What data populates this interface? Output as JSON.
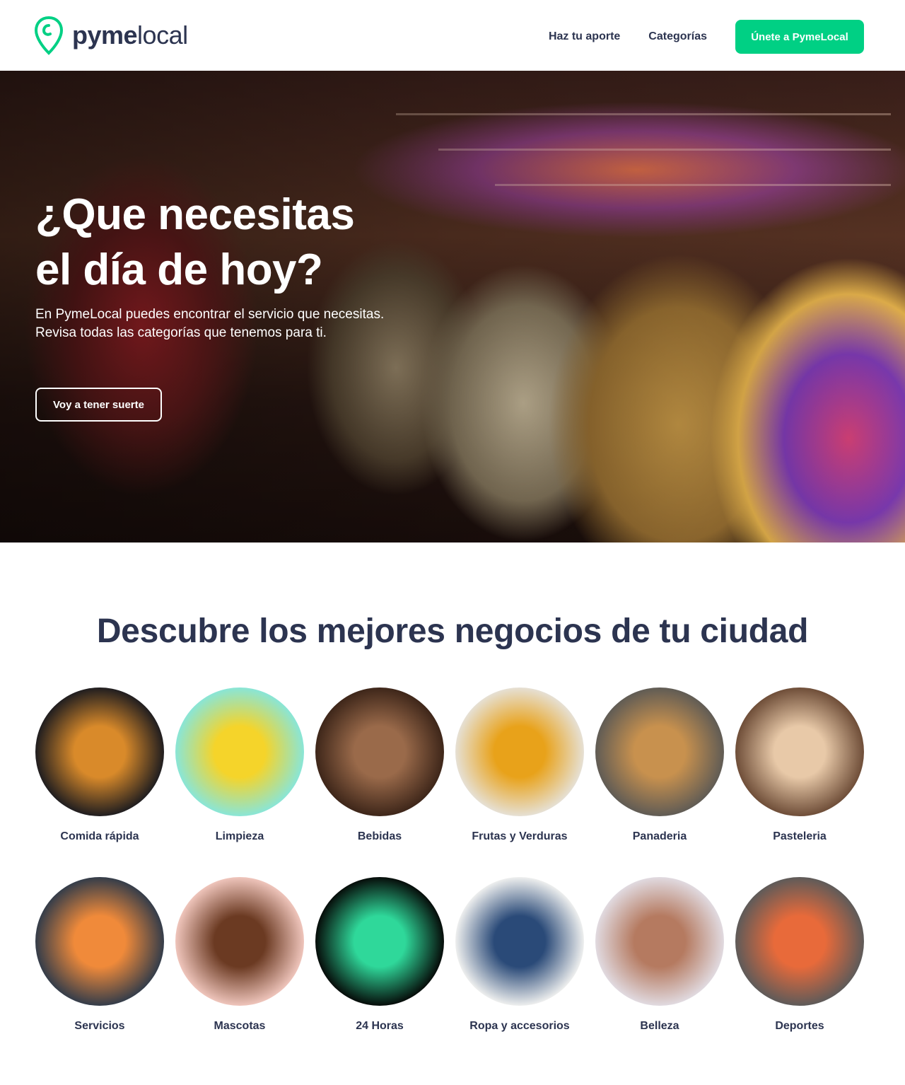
{
  "brand": {
    "logo_bold": "pyme",
    "logo_regular": "local",
    "accent": "#00d084",
    "text_color": "#2c3450"
  },
  "nav": {
    "items": [
      "Haz tu aporte",
      "Categorías"
    ],
    "cta": "Únete a PymeLocal"
  },
  "hero": {
    "title_line1": "¿Que necesitas",
    "title_line2": "el día de hoy?",
    "subtitle_line1": "En PymeLocal puedes encontrar el servicio que necesitas.",
    "subtitle_line2": "Revisa todas las categorías que tenemos para ti.",
    "button": "Voy a tener suerte"
  },
  "section": {
    "title": "Descubre los mejores negocios de tu ciudad"
  },
  "categories": [
    {
      "label": "Comida rápida",
      "icon": "fries-photo",
      "colors": [
        "#1a1a1f",
        "#d98a2a"
      ]
    },
    {
      "label": "Limpieza",
      "icon": "spray-bottle-photo",
      "colors": [
        "#86e6dc",
        "#f5d42a"
      ]
    },
    {
      "label": "Bebidas",
      "icon": "coffee-pour-photo",
      "colors": [
        "#3b2418",
        "#9a6a4a"
      ]
    },
    {
      "label": "Frutas y Verduras",
      "icon": "vegetables-photo",
      "colors": [
        "#e6e2da",
        "#e8a21a"
      ]
    },
    {
      "label": "Panaderia",
      "icon": "bread-photo",
      "colors": [
        "#5d5a55",
        "#c8914e"
      ]
    },
    {
      "label": "Pasteleria",
      "icon": "cake-photo",
      "colors": [
        "#6b4a35",
        "#e8c9a8"
      ]
    },
    {
      "label": "Servicios",
      "icon": "welder-photo",
      "colors": [
        "#2e3a4a",
        "#f08a3a"
      ]
    },
    {
      "label": "Mascotas",
      "icon": "dog-photo",
      "colors": [
        "#f3c9c0",
        "#6b3a22"
      ]
    },
    {
      "label": "24 Horas",
      "icon": "neon-sign-photo",
      "colors": [
        "#050605",
        "#2fd89a"
      ]
    },
    {
      "label": "Ropa y accesorios",
      "icon": "clothing-photo",
      "colors": [
        "#f4f4f2",
        "#2a4a78"
      ]
    },
    {
      "label": "Belleza",
      "icon": "makeup-brushes-photo",
      "colors": [
        "#e2dde4",
        "#b57a60"
      ]
    },
    {
      "label": "Deportes",
      "icon": "running-shoes-photo",
      "colors": [
        "#5a5a5a",
        "#e86a3a"
      ]
    }
  ]
}
